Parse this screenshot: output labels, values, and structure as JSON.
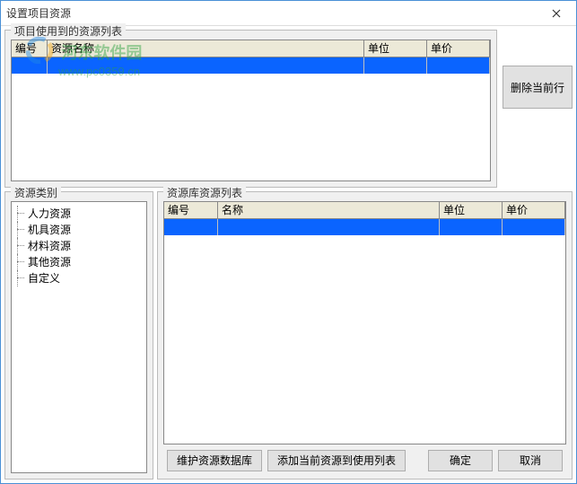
{
  "window": {
    "title": "设置项目资源"
  },
  "watermark": {
    "brand": "河东软件园",
    "url": "www.pc0359.cn"
  },
  "top": {
    "group_label": "项目使用到的资源列表",
    "columns": {
      "id": "编号",
      "name": "资源名称",
      "unit": "单位",
      "price": "单价"
    },
    "rows": []
  },
  "side": {
    "delete_current": "删除当前行"
  },
  "categories": {
    "group_label": "资源类别",
    "items": [
      "人力资源",
      "机具资源",
      "材料资源",
      "其他资源",
      "自定义"
    ]
  },
  "library": {
    "group_label": "资源库资源列表",
    "columns": {
      "id": "编号",
      "name": "名称",
      "unit": "单位",
      "price": "单价"
    },
    "rows": []
  },
  "footer": {
    "maintain_db": "维护资源数据库",
    "add_to_use": "添加当前资源到使用列表",
    "ok": "确定",
    "cancel": "取消"
  }
}
